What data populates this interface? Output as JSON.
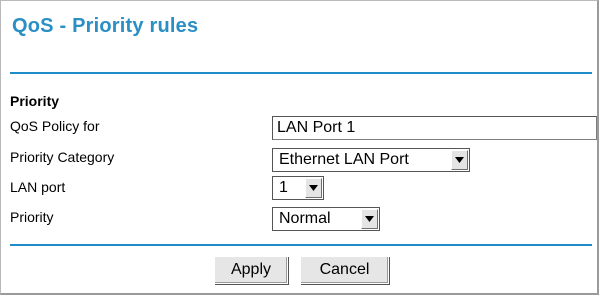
{
  "page": {
    "title": "QoS - Priority rules",
    "section": "Priority",
    "accent_color": "#1e8cc7"
  },
  "form": {
    "policy_label": "QoS Policy for",
    "policy_value": "LAN Port 1",
    "category_label": "Priority Category",
    "category_value": "Ethernet LAN Port",
    "lanport_label": "LAN port",
    "lanport_value": "1",
    "priority_label": "Priority",
    "priority_value": "Normal"
  },
  "actions": {
    "apply_label": "Apply",
    "cancel_label": "Cancel"
  },
  "icons": {
    "dropdown": "chevron-down-icon"
  }
}
